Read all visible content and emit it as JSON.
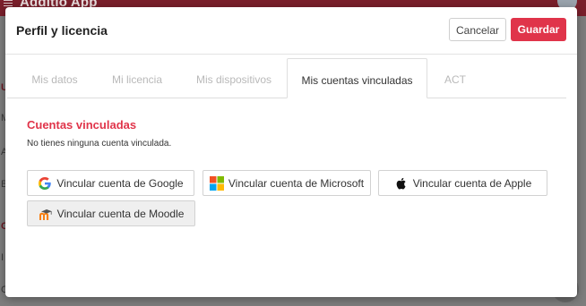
{
  "background": {
    "app_title": "Additio App",
    "side_letters": [
      "U",
      "M",
      "A",
      "B",
      "C",
      "I",
      "C"
    ]
  },
  "modal": {
    "title": "Perfil y licencia",
    "cancel_label": "Cancelar",
    "save_label": "Guardar",
    "tabs": [
      {
        "label": "Mis datos",
        "active": false
      },
      {
        "label": "Mi licencia",
        "active": false
      },
      {
        "label": "Mis dispositivos",
        "active": false
      },
      {
        "label": "Mis cuentas vinculadas",
        "active": true
      },
      {
        "label": "ACT",
        "active": false
      }
    ],
    "section_title": "Cuentas vinculadas",
    "section_note": "No tienes ninguna cuenta vinculada.",
    "link_buttons": [
      {
        "label": "Vincular cuenta de Google",
        "icon": "google-icon"
      },
      {
        "label": "Vincular cuenta de Microsoft",
        "icon": "microsoft-icon"
      },
      {
        "label": "Vincular cuenta de Apple",
        "icon": "apple-icon"
      },
      {
        "label": "Vincular cuenta de Moodle",
        "icon": "moodle-icon"
      }
    ]
  },
  "colors": {
    "accent": "#e0344a",
    "overlay": "#7d7d7d"
  }
}
